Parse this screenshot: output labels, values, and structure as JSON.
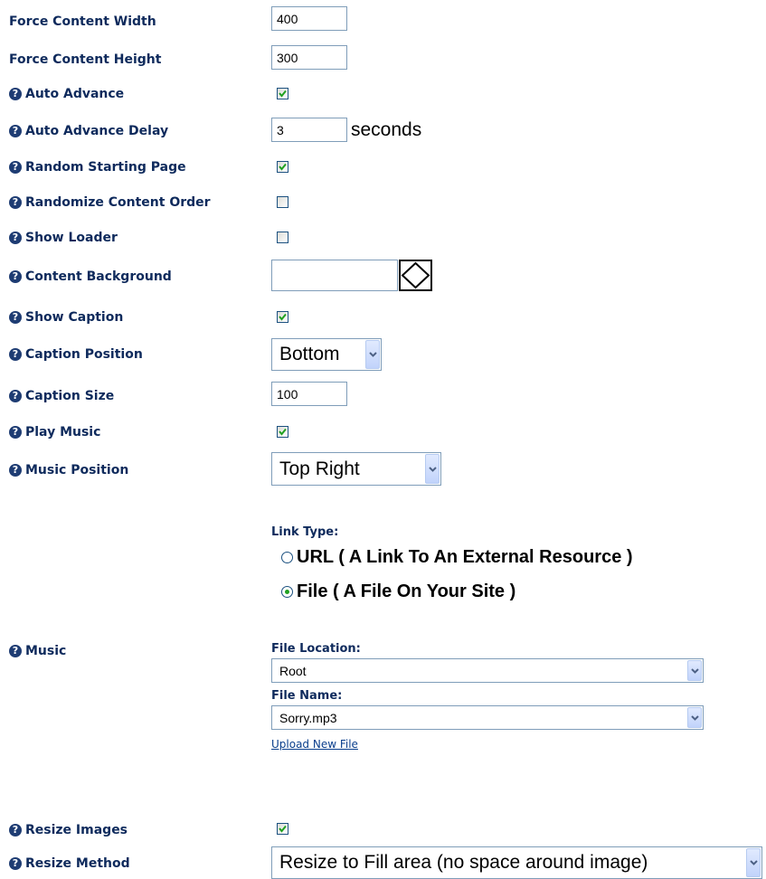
{
  "fields": {
    "force_content_width": {
      "label": "Force Content Width",
      "value": "400"
    },
    "force_content_height": {
      "label": "Force Content Height",
      "value": "300"
    },
    "auto_advance": {
      "label": "Auto Advance",
      "checked": true
    },
    "auto_advance_delay": {
      "label": "Auto Advance Delay",
      "value": "3",
      "unit": "seconds"
    },
    "random_starting_page": {
      "label": "Random Starting Page",
      "checked": true
    },
    "randomize_content_order": {
      "label": "Randomize Content Order",
      "checked": false
    },
    "show_loader": {
      "label": "Show Loader",
      "checked": false
    },
    "content_background": {
      "label": "Content Background",
      "value": ""
    },
    "show_caption": {
      "label": "Show Caption",
      "checked": true
    },
    "caption_position": {
      "label": "Caption Position",
      "selected": "Bottom"
    },
    "caption_size": {
      "label": "Caption Size",
      "value": "100"
    },
    "play_music": {
      "label": "Play Music",
      "checked": true
    },
    "music_position": {
      "label": "Music Position",
      "selected": "Top Right"
    },
    "music": {
      "label": "Music",
      "link_type_label": "Link Type:",
      "link_type_options": [
        {
          "label": "URL ( A Link To An External Resource )",
          "selected": false
        },
        {
          "label": "File ( A File On Your Site )",
          "selected": true
        }
      ],
      "file_location_label": "File Location:",
      "file_location_selected": "Root",
      "file_name_label": "File Name:",
      "file_name_selected": "Sorry.mp3",
      "upload_link": "Upload New File"
    },
    "resize_images": {
      "label": "Resize Images",
      "checked": true
    },
    "resize_method": {
      "label": "Resize Method",
      "selected": "Resize to Fill area (no space around image)"
    }
  },
  "icons": {
    "help": "help-question-icon",
    "checkmark": "checkmark-icon",
    "dropdown": "chevron-down-icon",
    "color_picker": "color-picker-icon"
  },
  "colors": {
    "label_text": "#0e2a5c",
    "input_border": "#7f9db9",
    "check_green": "#21a121",
    "link": "#0a3e8c"
  }
}
